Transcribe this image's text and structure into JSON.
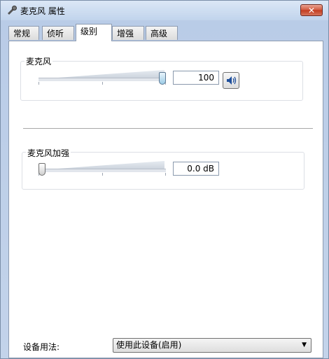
{
  "window": {
    "title": "麦克风 属性",
    "close_glyph": "✕"
  },
  "tabs": [
    {
      "label": "常规"
    },
    {
      "label": "侦听"
    },
    {
      "label": "级别",
      "active": true
    },
    {
      "label": "增强"
    },
    {
      "label": "高级"
    }
  ],
  "microphone": {
    "label": "麦克风",
    "value": "100",
    "level_percent": 100,
    "icon": "speaker-icon"
  },
  "boost": {
    "label": "麦克风加强",
    "value": "0.0 dB",
    "level_percent": 0
  },
  "device_usage": {
    "label": "设备用法:",
    "selected": "使用此设备(启用)"
  },
  "colors": {
    "thumb_active": "#9ccbe6",
    "close_button": "#c23b1f"
  }
}
